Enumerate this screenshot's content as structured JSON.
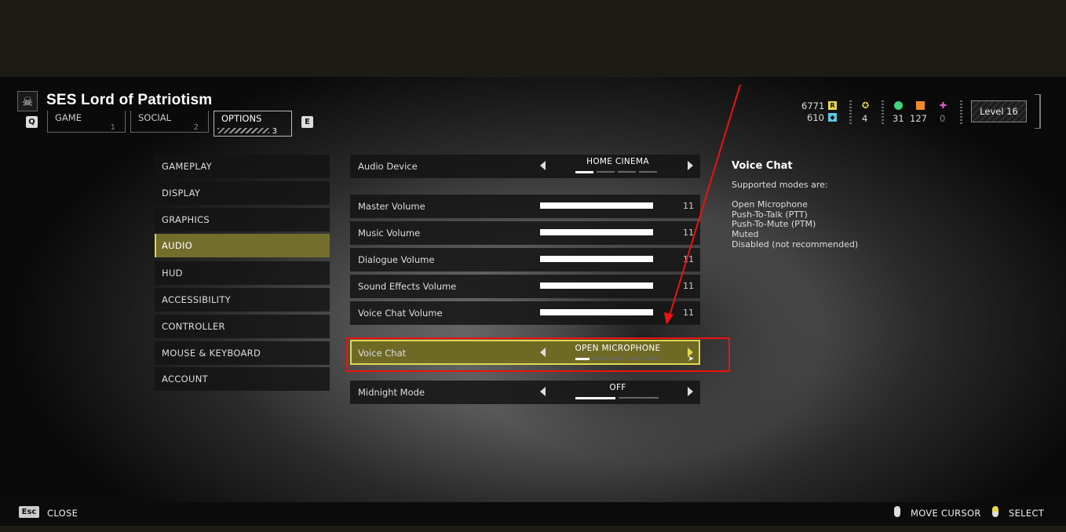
{
  "header": {
    "ship_name": "SES Lord of Patriotism",
    "prev_key": "Q",
    "next_key": "E",
    "tabs": [
      {
        "label": "GAME",
        "num": "1"
      },
      {
        "label": "SOCIAL",
        "num": "2"
      },
      {
        "label": "OPTIONS",
        "num": "3"
      }
    ]
  },
  "currencies": {
    "requisition": "6771",
    "requisition_icon": "R",
    "super_credits": "610",
    "medals": "4",
    "samples_common": "31",
    "samples_rare": "127",
    "samples_super": "0"
  },
  "level": "Level 16",
  "sidebar": {
    "items": [
      "GAMEPLAY",
      "DISPLAY",
      "GRAPHICS",
      "AUDIO",
      "HUD",
      "ACCESSIBILITY",
      "CONTROLLER",
      "MOUSE & KEYBOARD",
      "ACCOUNT"
    ],
    "active": "AUDIO"
  },
  "settings": {
    "audio_device": {
      "label": "Audio Device",
      "value": "HOME CINEMA",
      "option_count": 4,
      "selected_index": 0
    },
    "master_volume": {
      "label": "Master Volume",
      "value": "11"
    },
    "music_volume": {
      "label": "Music Volume",
      "value": "11"
    },
    "dialogue_volume": {
      "label": "Dialogue Volume",
      "value": "11"
    },
    "sfx_volume": {
      "label": "Sound Effects Volume",
      "value": "11"
    },
    "voice_chat_volume": {
      "label": "Voice Chat Volume",
      "value": "11"
    },
    "voice_chat": {
      "label": "Voice Chat",
      "value": "OPEN MICROPHONE",
      "option_count": 5,
      "selected_index": 0
    },
    "midnight_mode": {
      "label": "Midnight Mode",
      "value": "OFF",
      "option_count": 2,
      "selected_index": 0
    }
  },
  "info": {
    "title": "Voice Chat",
    "intro": "Supported modes are:",
    "modes": [
      "Open Microphone",
      "Push-To-Talk (PTT)",
      "Push-To-Mute (PTM)",
      "Muted",
      "Disabled (not recommended)"
    ]
  },
  "footer": {
    "esc_key": "Esc",
    "close": "CLOSE",
    "move_cursor": "MOVE CURSOR",
    "select": "SELECT"
  },
  "colors": {
    "accent": "#e3d84c",
    "active_bg": "#736e2b",
    "annotation_red": "#e11111"
  }
}
